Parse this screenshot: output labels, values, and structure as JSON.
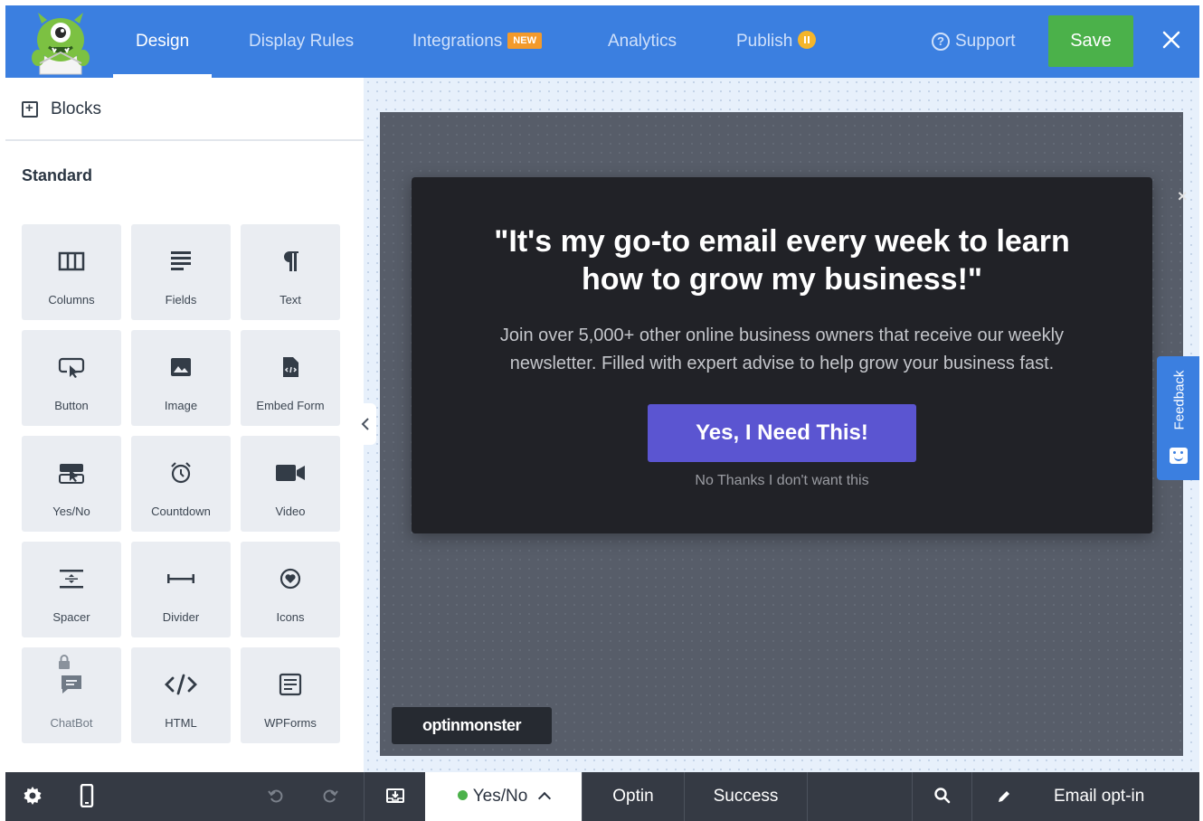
{
  "nav": {
    "tabs": [
      {
        "label": "Design",
        "active": true
      },
      {
        "label": "Display Rules"
      },
      {
        "label": "Integrations",
        "badge": "NEW"
      },
      {
        "label": "Analytics"
      },
      {
        "label": "Publish"
      }
    ],
    "support_label": "Support",
    "save_label": "Save",
    "colors": {
      "bar": "#3b7fe0",
      "save": "#4bb14a",
      "badge": "#f39a2b"
    }
  },
  "sidebar": {
    "header_label": "Blocks",
    "section_title": "Standard",
    "blocks": [
      {
        "label": "Columns",
        "icon": "columns-icon"
      },
      {
        "label": "Fields",
        "icon": "fields-icon"
      },
      {
        "label": "Text",
        "icon": "pilcrow-icon"
      },
      {
        "label": "Button",
        "icon": "button-icon"
      },
      {
        "label": "Image",
        "icon": "image-icon"
      },
      {
        "label": "Embed Form",
        "icon": "embed-form-icon"
      },
      {
        "label": "Yes/No",
        "icon": "yes-no-icon"
      },
      {
        "label": "Countdown",
        "icon": "alarm-clock-icon"
      },
      {
        "label": "Video",
        "icon": "video-camera-icon"
      },
      {
        "label": "Spacer",
        "icon": "spacer-icon"
      },
      {
        "label": "Divider",
        "icon": "divider-icon"
      },
      {
        "label": "Icons",
        "icon": "heart-circle-icon"
      },
      {
        "label": "ChatBot",
        "icon": "chat-icon",
        "locked": true
      },
      {
        "label": "HTML",
        "icon": "code-icon"
      },
      {
        "label": "WPForms",
        "icon": "wpforms-icon"
      }
    ]
  },
  "popup": {
    "title": "\"It's my go-to email every week to learn how to grow my business!\"",
    "body": "Join over 5,000+ other online business owners that receive our weekly newsletter. Filled with expert advise to help grow your business fast.",
    "cta": "Yes, I Need This!",
    "no_thanks": "No Thanks I don't want this",
    "brand": "optinmonster",
    "colors": {
      "panel": "#212227",
      "cta": "#5b55d1"
    }
  },
  "feedback_label": "Feedback",
  "bottombar": {
    "views": [
      {
        "label": "Yes/No",
        "active": true
      },
      {
        "label": "Optin"
      },
      {
        "label": "Success"
      }
    ],
    "campaign_name": "Email opt-in"
  }
}
